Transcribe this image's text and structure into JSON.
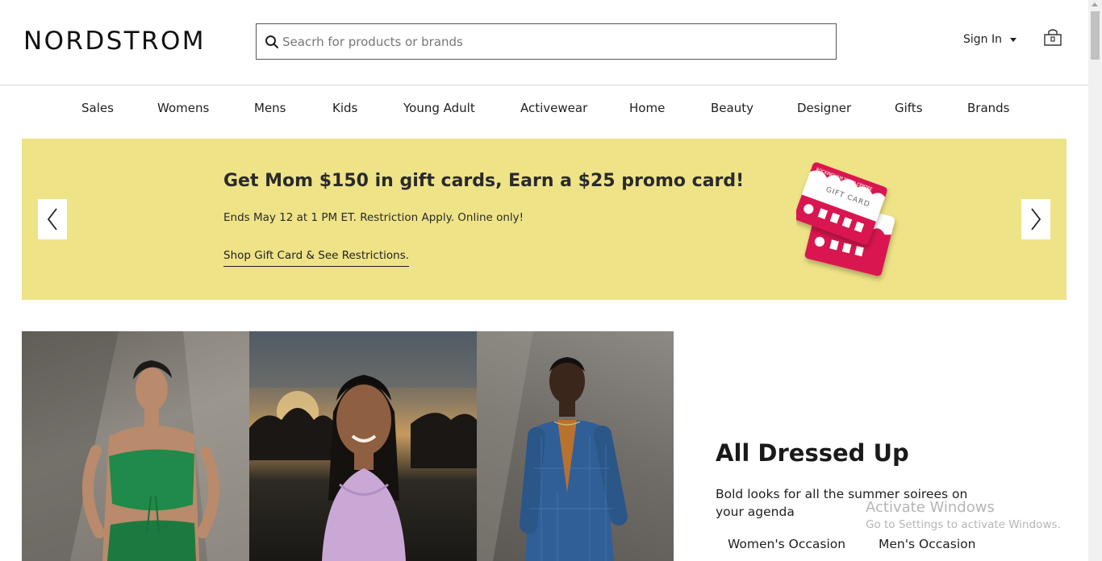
{
  "header": {
    "logo": "NORDSTROM",
    "search_placeholder": "Seacrh for products or brands",
    "signin_label": "Sign In"
  },
  "nav": {
    "items": [
      "Sales",
      "Womens",
      "Mens",
      "Kids",
      "Young Adult",
      "Activewear",
      "Home",
      "Beauty",
      "Designer",
      "Gifts",
      "Brands"
    ]
  },
  "banner": {
    "title": "Get Mom $150 in gift cards, Earn a $25 promo card!",
    "subtitle": "Ends May 12 at 1 PM ET. Restriction Apply. Online only!",
    "link": "Shop Gift Card & See Restrictions.",
    "background_color": "#efe387",
    "gift_card_text": "GIFT CARD",
    "gift_card_brand": "ROCKINGHAM TOWN CENTRE"
  },
  "feature": {
    "title": "All Dressed Up",
    "description": "Bold looks for all the summer soirees on your agenda",
    "links": [
      "Women's Occasion",
      "Men's Occasion"
    ]
  },
  "watermark": {
    "line1": "Activate Windows",
    "line2": "Go to Settings to activate Windows."
  },
  "icons": {
    "search": "search-icon",
    "bag": "shopping-bag-icon",
    "prev": "chevron-left-icon",
    "next": "chevron-right-icon",
    "caret": "caret-down-icon"
  }
}
